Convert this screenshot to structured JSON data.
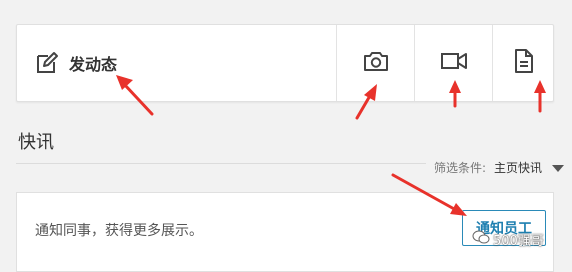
{
  "composer": {
    "post_label": "发动态",
    "buttons": [
      {
        "icon": "camera-icon"
      },
      {
        "icon": "video-camera-icon"
      },
      {
        "icon": "document-icon"
      }
    ]
  },
  "feed": {
    "title": "快讯",
    "filter": {
      "label": "筛选条件:",
      "value": "主页快讯"
    }
  },
  "notify": {
    "text": "通知同事，获得更多展示。",
    "button_label": "通知员工"
  },
  "watermark": {
    "text": "500强哥"
  },
  "colors": {
    "annotation_arrow": "#e8322b",
    "accent_blue": "#1e7fb0",
    "page_bg": "#f2f2f2"
  }
}
